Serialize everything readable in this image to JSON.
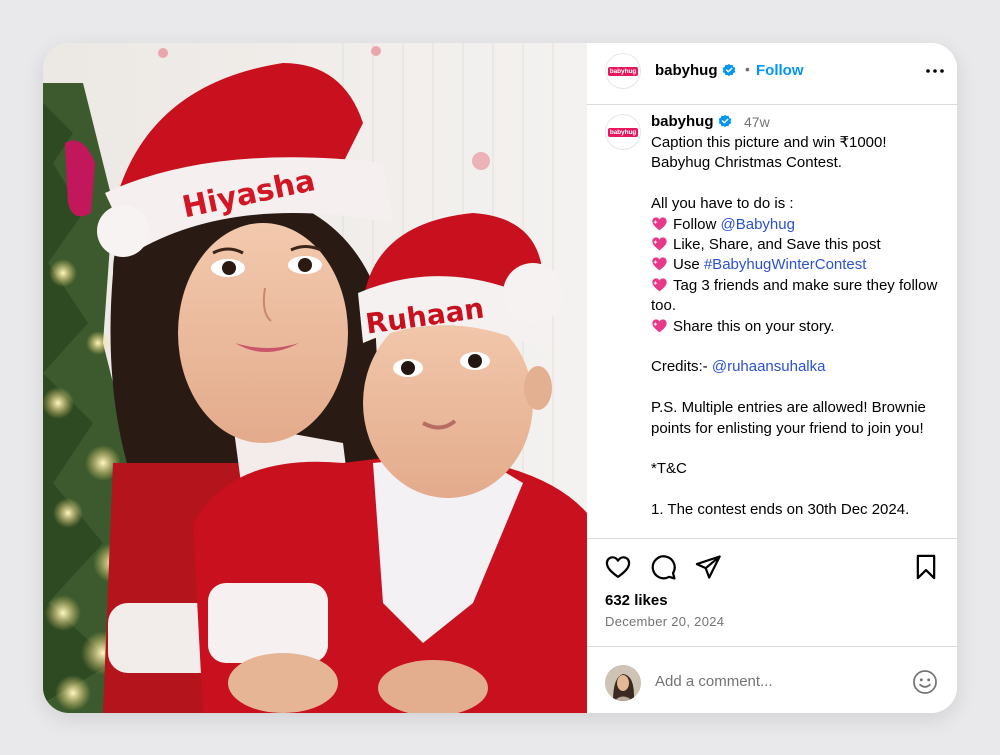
{
  "post": {
    "username": "babyhug",
    "logo_text": "babyhug",
    "follow_label": "Follow",
    "dot": "•",
    "time_ago": "47w",
    "caption_lines": [
      {
        "text": "Caption this picture and win ₹1000!"
      },
      {
        "text": "Babyhug Christmas Contest."
      },
      {
        "text": ""
      },
      {
        "text": "All you have to do is :"
      },
      {
        "heart": true,
        "text": "Follow ",
        "link": "@Babyhug"
      },
      {
        "heart": true,
        "text": "Like, Share, and Save this post"
      },
      {
        "heart": true,
        "text": "Use ",
        "link": "#BabyhugWinterContest"
      },
      {
        "heart": true,
        "text": "Tag 3 friends and make sure they follow too.",
        "wrap": true
      },
      {
        "heart": true,
        "text": "Share this on your story."
      },
      {
        "text": ""
      },
      {
        "text": "Credits:- ",
        "link": "@ruhaansuhalka"
      },
      {
        "text": ""
      },
      {
        "text": "P.S. Multiple entries are allowed! Brownie points for enlisting your friend to join you!",
        "wrap": true
      },
      {
        "text": ""
      },
      {
        "text": "*T&C"
      },
      {
        "text": ""
      },
      {
        "text": "1. The contest ends on 30th Dec 2024."
      }
    ],
    "likes": "632 likes",
    "date": "December 20, 2024",
    "comment_placeholder": "Add a comment...",
    "photo_hat_names": [
      "Hiyasha",
      "Ruhaan"
    ]
  },
  "colors": {
    "follow_blue": "#0095f6",
    "link_blue": "#2c50d6",
    "verified_blue": "#0095f6",
    "brand_pink": "#e6175c",
    "heart_pink": "#e8388a"
  },
  "icons": [
    "verified-badge-icon",
    "more-options-icon",
    "like-heart-icon",
    "comment-icon",
    "share-icon",
    "save-bookmark-icon",
    "emoji-icon"
  ]
}
